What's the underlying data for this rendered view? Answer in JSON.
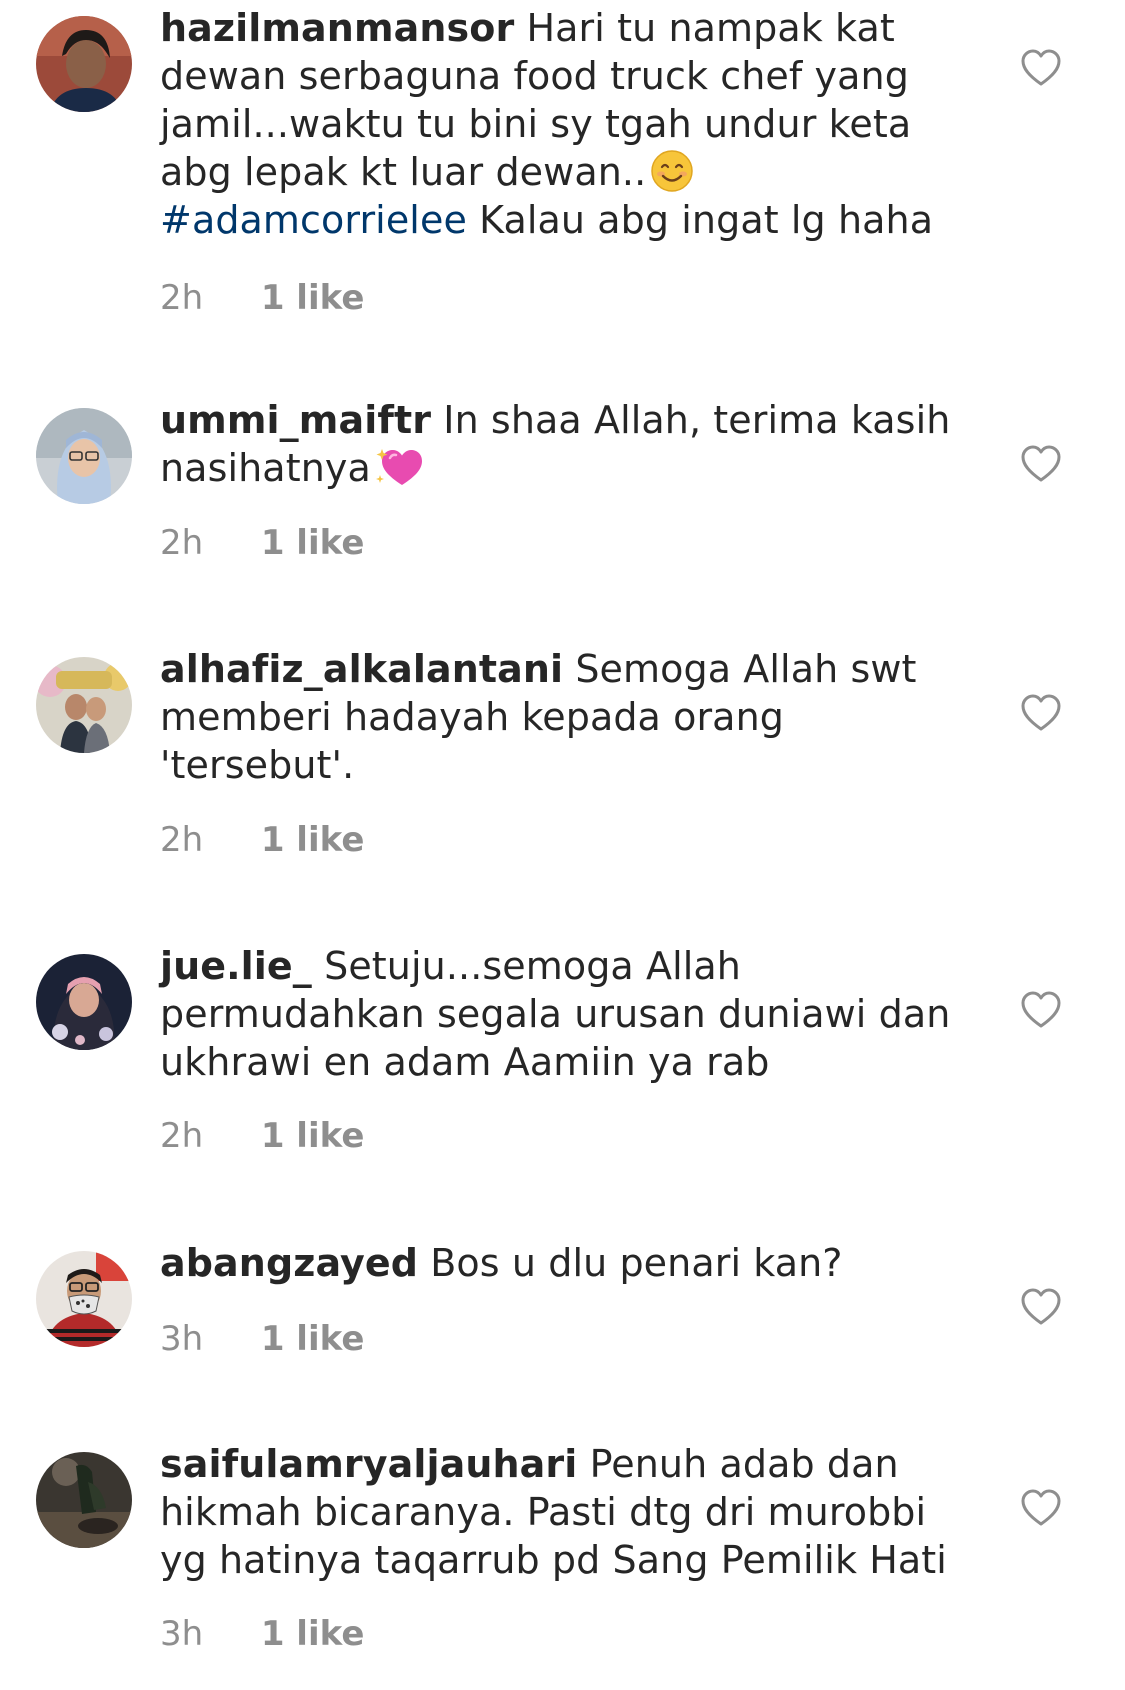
{
  "comments": [
    {
      "username": "hazilmanmansor",
      "text_parts": [
        "Hari tu nampak kat dewan serbaguna food truck chef yang jamil...waktu tu bini sy tgah undur keta abg lepak kt luar dewan.."
      ],
      "emoji": "smiling-face-emoji",
      "hashtag": "#adamcorrielee",
      "text_after": "Kalau abg ingat lg haha",
      "time": "2h",
      "likes": "1 like"
    },
    {
      "username": "ummi_maiftr",
      "text_parts": [
        "In shaa Allah, terima kasih nasihatnya"
      ],
      "emoji": "sparkling-heart-emoji",
      "time": "2h",
      "likes": "1 like"
    },
    {
      "username": "alhafiz_alkalantani",
      "text_parts": [
        "Semoga Allah swt memberi hadayah kepada orang 'tersebut'."
      ],
      "time": "2h",
      "likes": "1 like"
    },
    {
      "username": "jue.lie_",
      "text_parts": [
        "Setuju...semoga Allah permudahkan segala urusan duniawi dan ukhrawi en adam  Aamiin ya rab"
      ],
      "time": "2h",
      "likes": "1 like"
    },
    {
      "username": "abangzayed",
      "text_parts": [
        "Bos u dlu penari kan?"
      ],
      "time": "3h",
      "likes": "1 like"
    },
    {
      "username": "saifulamryaljauhari",
      "text_parts": [
        "Penuh adab dan hikmah bicaranya. Pasti dtg dri murobbi yg hatinya taqarrub pd Sang Pemilik Hati"
      ],
      "time": "3h",
      "likes": "1 like"
    }
  ],
  "icons": {
    "like": "heart-outline-icon"
  },
  "colors": {
    "text": "#262626",
    "secondary": "#8e8e8e",
    "hashtag": "#00376b",
    "heart_stroke": "#8e8e8e"
  }
}
